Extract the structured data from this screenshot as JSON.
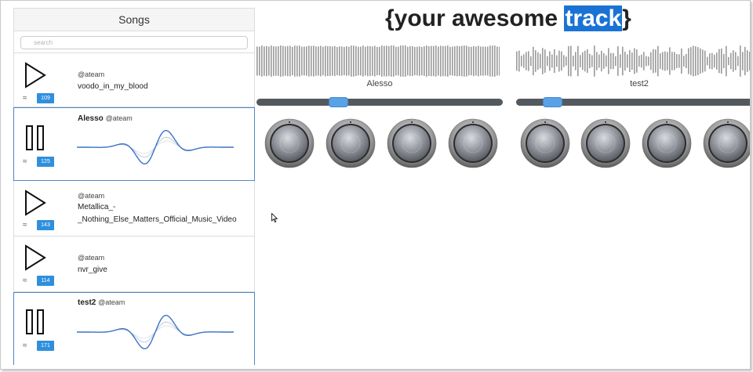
{
  "sidebar": {
    "header": "Songs",
    "search_placeholder": "search",
    "songs": [
      {
        "state": "play",
        "user": "@ateam",
        "title": "voodo_in_my_blood",
        "bpm": "109"
      },
      {
        "state": "pause",
        "user": "@ateam",
        "title": "Alesso",
        "bpm": "125"
      },
      {
        "state": "play",
        "user": "@ateam",
        "title": "Metallica_-",
        "title_line2": "_Nothing_Else_Matters_Official_Music_Video",
        "bpm": "143"
      },
      {
        "state": "play",
        "user": "@ateam",
        "title": "nvr_give",
        "bpm": "114"
      },
      {
        "state": "pause",
        "user": "@ateam",
        "title": "test2",
        "bpm": "171"
      }
    ]
  },
  "main": {
    "title_prefix": "{your awesome ",
    "title_highlight": "track",
    "title_suffix": "}",
    "decks": [
      {
        "name": "Alesso",
        "slider_position": 0.33
      },
      {
        "name": "test2",
        "slider_position": 0.16
      }
    ]
  },
  "colors": {
    "accent": "#2f8fdc",
    "highlight": "#1a73d4",
    "wave_gray": "#9a9a9a",
    "slider_track": "#54595e",
    "slider_thumb": "#5aa2e6",
    "active_border": "#4f86c6"
  },
  "icons": [
    "play-icon",
    "pause-icon",
    "waveform-icon",
    "knob-icon",
    "mouse-cursor-icon"
  ]
}
